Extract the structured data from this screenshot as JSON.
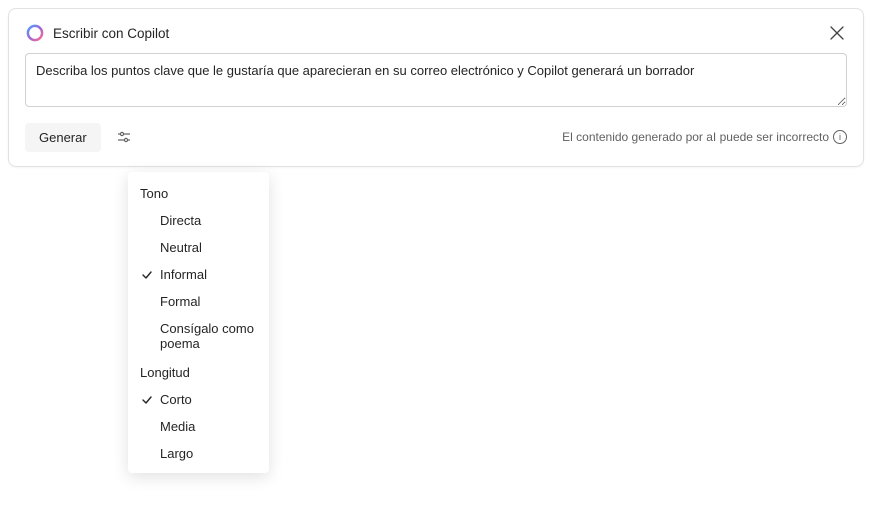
{
  "header": {
    "title": "Escribir con Copilot"
  },
  "prompt": {
    "value": "Describa los puntos clave que le gustaría que aparecieran en su correo electrónico y Copilot generará un borrador"
  },
  "actions": {
    "generate_label": "Generar"
  },
  "disclaimer": {
    "text": "El contenido generado por aI puede ser incorrecto"
  },
  "dropdown": {
    "tone": {
      "label": "Tono",
      "options": [
        {
          "label": "Directa",
          "selected": false
        },
        {
          "label": "Neutral",
          "selected": false
        },
        {
          "label": "Informal",
          "selected": true
        },
        {
          "label": "Formal",
          "selected": false
        },
        {
          "label": "Consígalo como poema",
          "selected": false
        }
      ]
    },
    "length": {
      "label": "Longitud",
      "options": [
        {
          "label": "Corto",
          "selected": true
        },
        {
          "label": "Media",
          "selected": false
        },
        {
          "label": "Largo",
          "selected": false
        }
      ]
    }
  }
}
